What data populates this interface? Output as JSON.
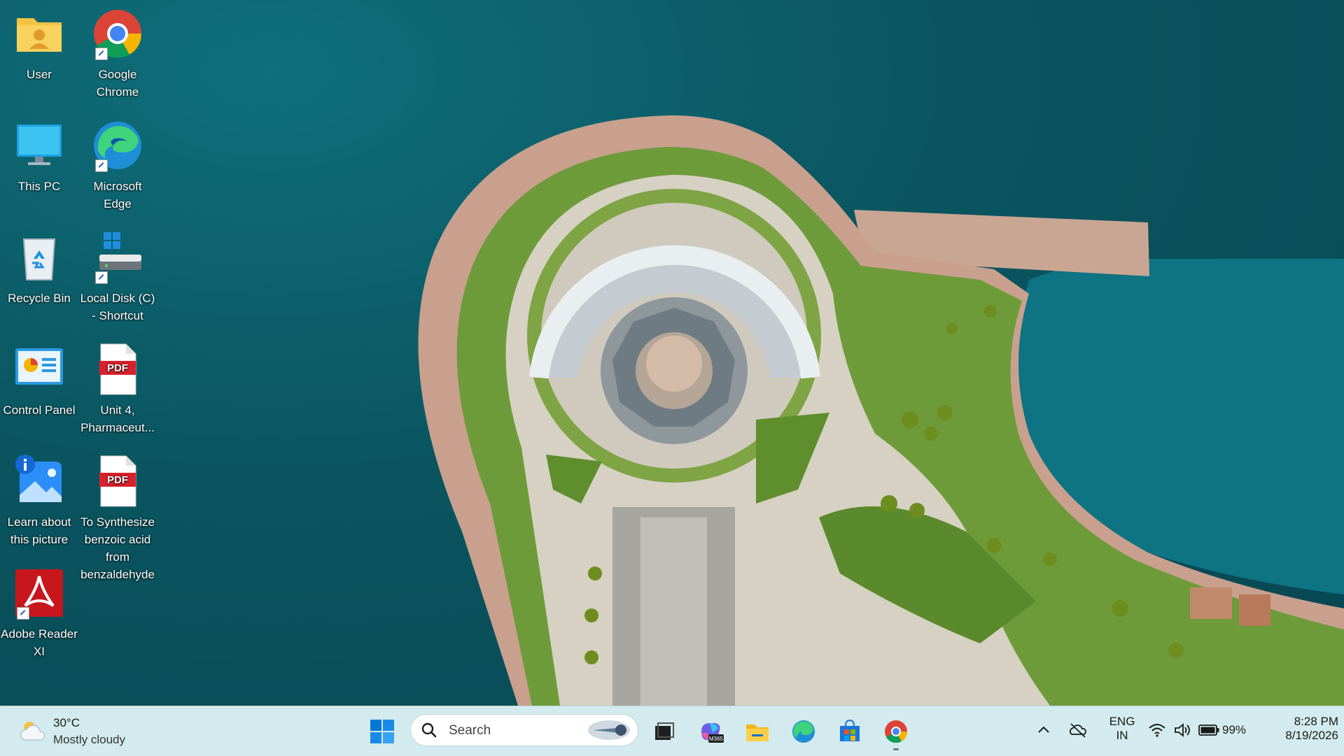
{
  "desktop": {
    "icons": [
      {
        "label": "User",
        "icon": "user-folder-icon"
      },
      {
        "label": "Google Chrome",
        "icon": "chrome-icon",
        "shortcut": true
      },
      {
        "label": "This PC",
        "icon": "monitor-icon"
      },
      {
        "label": "Microsoft Edge",
        "icon": "edge-icon",
        "shortcut": true
      },
      {
        "label": "Recycle Bin",
        "icon": "recycle-bin-icon"
      },
      {
        "label": "Local Disk (C) - Shortcut",
        "icon": "drive-icon",
        "shortcut": true
      },
      {
        "label": "Control Panel",
        "icon": "control-panel-icon"
      },
      {
        "label": "Unit 4, Pharmaceut...",
        "icon": "pdf-icon"
      },
      {
        "label": "Learn about this picture",
        "icon": "learn-picture-icon"
      },
      {
        "label": "To Synthesize benzoic acid from benzaldehyde",
        "icon": "pdf-icon"
      },
      {
        "label": "Adobe Reader XI",
        "icon": "adobe-reader-icon",
        "shortcut": true
      }
    ],
    "pdf_badge": "PDF"
  },
  "taskbar": {
    "weather": {
      "temp": "30°C",
      "condition": "Mostly cloudy"
    },
    "search": {
      "placeholder": "Search"
    },
    "copilot_badge": "M365",
    "tray": {
      "language_line1": "ENG",
      "language_line2": "IN",
      "battery": "99%",
      "time": "8:28 PM",
      "date": "8/19/2026"
    }
  },
  "colors": {
    "taskbar_bg": "#d3ebee",
    "water": "#0a5560",
    "accent": "#0067c0"
  }
}
